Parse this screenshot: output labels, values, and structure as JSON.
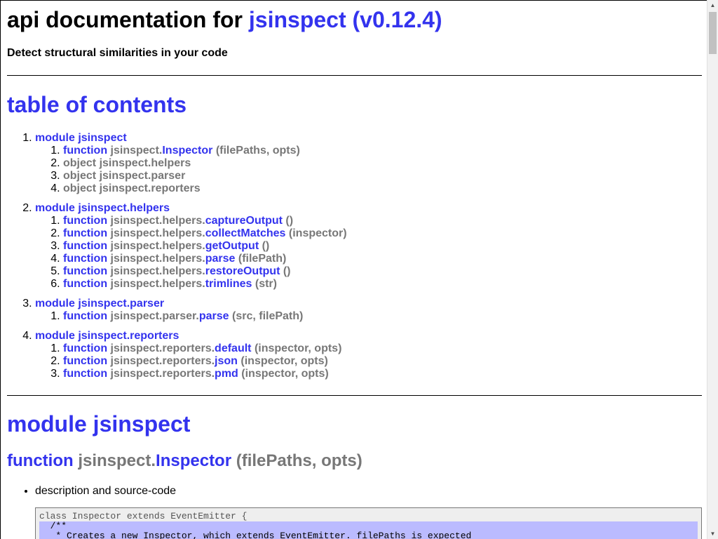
{
  "header": {
    "title_prefix": "api documentation for",
    "title_link": "jsinspect (v0.12.4)",
    "subtitle": "Detect structural similarities in your code"
  },
  "toc": {
    "heading": "table of contents",
    "modules": [
      {
        "label": "module jsinspect",
        "items": [
          {
            "kind": "function",
            "prefix": "jsinspect.",
            "name": "Inspector",
            "args": "(filePaths, opts)"
          },
          {
            "kind": "object jsinspect.helpers",
            "prefix": "",
            "name": "",
            "args": ""
          },
          {
            "kind": "object jsinspect.parser",
            "prefix": "",
            "name": "",
            "args": ""
          },
          {
            "kind": "object jsinspect.reporters",
            "prefix": "",
            "name": "",
            "args": ""
          }
        ]
      },
      {
        "label": "module jsinspect.helpers",
        "items": [
          {
            "kind": "function",
            "prefix": "jsinspect.helpers.",
            "name": "captureOutput",
            "args": "()"
          },
          {
            "kind": "function",
            "prefix": "jsinspect.helpers.",
            "name": "collectMatches",
            "args": "(inspector)"
          },
          {
            "kind": "function",
            "prefix": "jsinspect.helpers.",
            "name": "getOutput",
            "args": "()"
          },
          {
            "kind": "function",
            "prefix": "jsinspect.helpers.",
            "name": "parse",
            "args": "(filePath)"
          },
          {
            "kind": "function",
            "prefix": "jsinspect.helpers.",
            "name": "restoreOutput",
            "args": "()"
          },
          {
            "kind": "function",
            "prefix": "jsinspect.helpers.",
            "name": "trimlines",
            "args": "(str)"
          }
        ]
      },
      {
        "label": "module jsinspect.parser",
        "items": [
          {
            "kind": "function",
            "prefix": "jsinspect.parser.",
            "name": "parse",
            "args": "(src, filePath)"
          }
        ]
      },
      {
        "label": "module jsinspect.reporters",
        "items": [
          {
            "kind": "function",
            "prefix": "jsinspect.reporters.",
            "name": "default",
            "args": "(inspector, opts)"
          },
          {
            "kind": "function",
            "prefix": "jsinspect.reporters.",
            "name": "json",
            "args": "(inspector, opts)"
          },
          {
            "kind": "function",
            "prefix": "jsinspect.reporters.",
            "name": "pmd",
            "args": "(inspector, opts)"
          }
        ]
      }
    ]
  },
  "section": {
    "module_heading": "module jsinspect",
    "function_kind": "function",
    "function_prefix": "jsinspect.",
    "function_name": "Inspector",
    "function_args": "(filePaths, opts)",
    "bullet": "description and source-code",
    "code_lines": [
      {
        "text": "class Inspector extends EventEmitter {",
        "highlight": false
      },
      {
        "text": "  /**",
        "highlight": true
      },
      {
        "text": "   * Creates a new Inspector, which extends EventEmitter. filePaths is expected",
        "highlight": true
      }
    ]
  },
  "colors": {
    "link": "#3333ee",
    "muted": "#777777",
    "code_highlight": "#bbbbff",
    "code_background": "#eeeeee"
  }
}
